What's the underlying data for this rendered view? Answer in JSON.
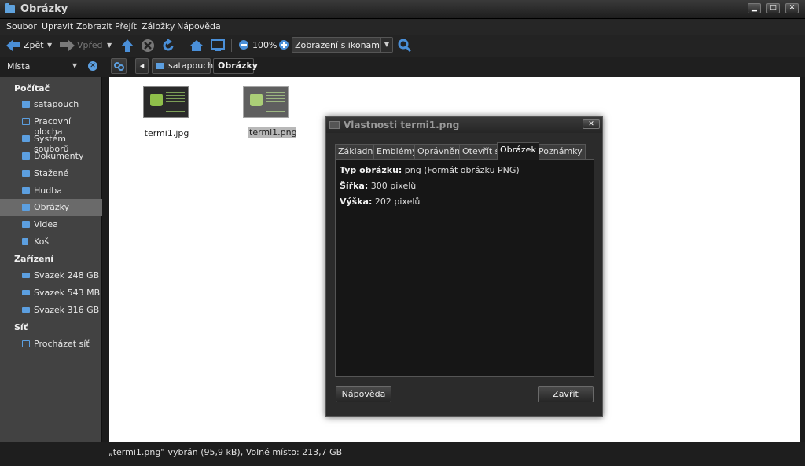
{
  "window": {
    "title": "Obrázky",
    "controls": {
      "minimize": "▁",
      "maximize": "□",
      "close": "✕"
    }
  },
  "menubar": [
    "Soubor",
    "Upravit",
    "Zobrazit",
    "Přejít",
    "Záložky",
    "Nápověda"
  ],
  "toolbar": {
    "back_label": "Zpět",
    "forward_label": "Vpřed",
    "zoom": "100%",
    "view_mode": "Zobrazení s ikonami",
    "icons": [
      "arrow-left-icon",
      "arrow-right-icon",
      "up-icon",
      "stop-icon",
      "reload-icon",
      "home-icon",
      "computer-icon",
      "zoom-out-icon",
      "zoom-in-icon",
      "search-icon"
    ]
  },
  "sidebar": {
    "header": "Místa",
    "sections": [
      {
        "title": "Počítač",
        "items": [
          "satapouch",
          "Pracovní plocha",
          "Systém souborů",
          "Dokumenty",
          "Stažené",
          "Hudba",
          "Obrázky",
          "Videa",
          "Koš"
        ]
      },
      {
        "title": "Zařízení",
        "items": [
          "Svazek 248 GB",
          "Svazek 543 MB",
          "Svazek 316 GB"
        ]
      },
      {
        "title": "Síť",
        "items": [
          "Procházet síť"
        ]
      }
    ],
    "selected": "Obrázky"
  },
  "breadcrumb": [
    "satapouch",
    "Obrázky"
  ],
  "files": [
    {
      "name": "termi1.jpg",
      "selected": false
    },
    {
      "name": "termi1.png",
      "selected": true
    }
  ],
  "statusbar": "„termi1.png“ vybrán (95,9 kB), Volné místo: 213,7 GB",
  "dialog": {
    "title": "Vlastnosti termi1.png",
    "tabs": [
      "Základní",
      "Emblémy",
      "Oprávnění",
      "Otevřít s",
      "Obrázek",
      "Poznámky"
    ],
    "active_tab": "Obrázek",
    "properties": [
      {
        "label": "Typ obrázku:",
        "value": " png (Formát obrázku PNG)"
      },
      {
        "label": "Šířka:",
        "value": " 300 pixelů"
      },
      {
        "label": "Výška:",
        "value": " 202 pixelů"
      }
    ],
    "help_button": "Nápověda",
    "close_button": "Zavřít"
  },
  "colors": {
    "accent": "#4a8fd8",
    "selection": "#6a6a6a",
    "background": "#1b1b1b"
  }
}
